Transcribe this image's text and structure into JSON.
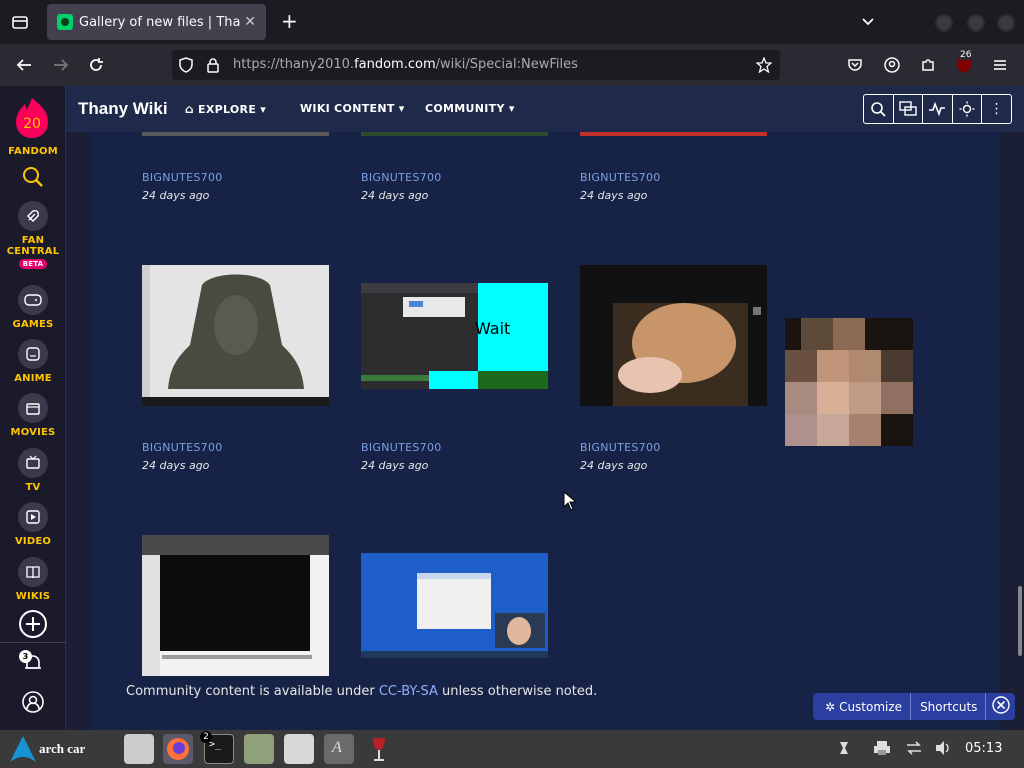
{
  "browser": {
    "tab_title": "Gallery of new files | Thany W",
    "tab_close": "✕",
    "new_tab": "+",
    "url_prefix": "https://thany2010.",
    "url_domain": "fandom.com",
    "url_path": "/wiki/Special:NewFiles",
    "extension_badge": "26"
  },
  "fandom_rail": {
    "logo_number": "20",
    "brand": "FANDOM",
    "items": [
      {
        "label": "FAN\nCENTRAL",
        "line1": "FAN",
        "line2": "CENTRAL",
        "badge": "BETA",
        "icon": "rocket-icon"
      },
      {
        "label": "GAMES",
        "icon": "gamepad-icon"
      },
      {
        "label": "ANIME",
        "icon": "anime-face-icon"
      },
      {
        "label": "MOVIES",
        "icon": "clapper-icon"
      },
      {
        "label": "TV",
        "icon": "tv-icon"
      },
      {
        "label": "VIDEO",
        "icon": "play-icon"
      },
      {
        "label": "WIKIS",
        "icon": "book-icon"
      }
    ],
    "notification_count": "3"
  },
  "wiki": {
    "title": "Thany Wiki",
    "menu": [
      {
        "label": "EXPLORE"
      },
      {
        "label": "WIKI CONTENT"
      },
      {
        "label": "COMMUNITY"
      }
    ]
  },
  "gallery": {
    "rows": [
      {
        "items": [
          {
            "user": "BIGNUTES700",
            "date": "24 days ago"
          },
          {
            "user": "BIGNUTES700",
            "date": "24 days ago"
          },
          {
            "user": "BIGNUTES700",
            "date": "24 days ago"
          }
        ]
      },
      {
        "items": [
          {
            "user": "BIGNUTES700",
            "date": "24 days ago"
          },
          {
            "user": "BIGNUTES700",
            "date": "24 days ago"
          },
          {
            "user": "BIGNUTES700",
            "date": "24 days ago"
          }
        ]
      }
    ],
    "wait_text": "Wait"
  },
  "footer": {
    "prefix": "Community content is available under ",
    "license": "CC-BY-SA",
    "suffix": " unless otherwise noted."
  },
  "toolbar": {
    "customize_label": "Customize",
    "shortcuts_label": "Shortcuts"
  },
  "taskbar": {
    "start_label": "arch car",
    "terminal_badge": "2",
    "clock": "05:13"
  }
}
